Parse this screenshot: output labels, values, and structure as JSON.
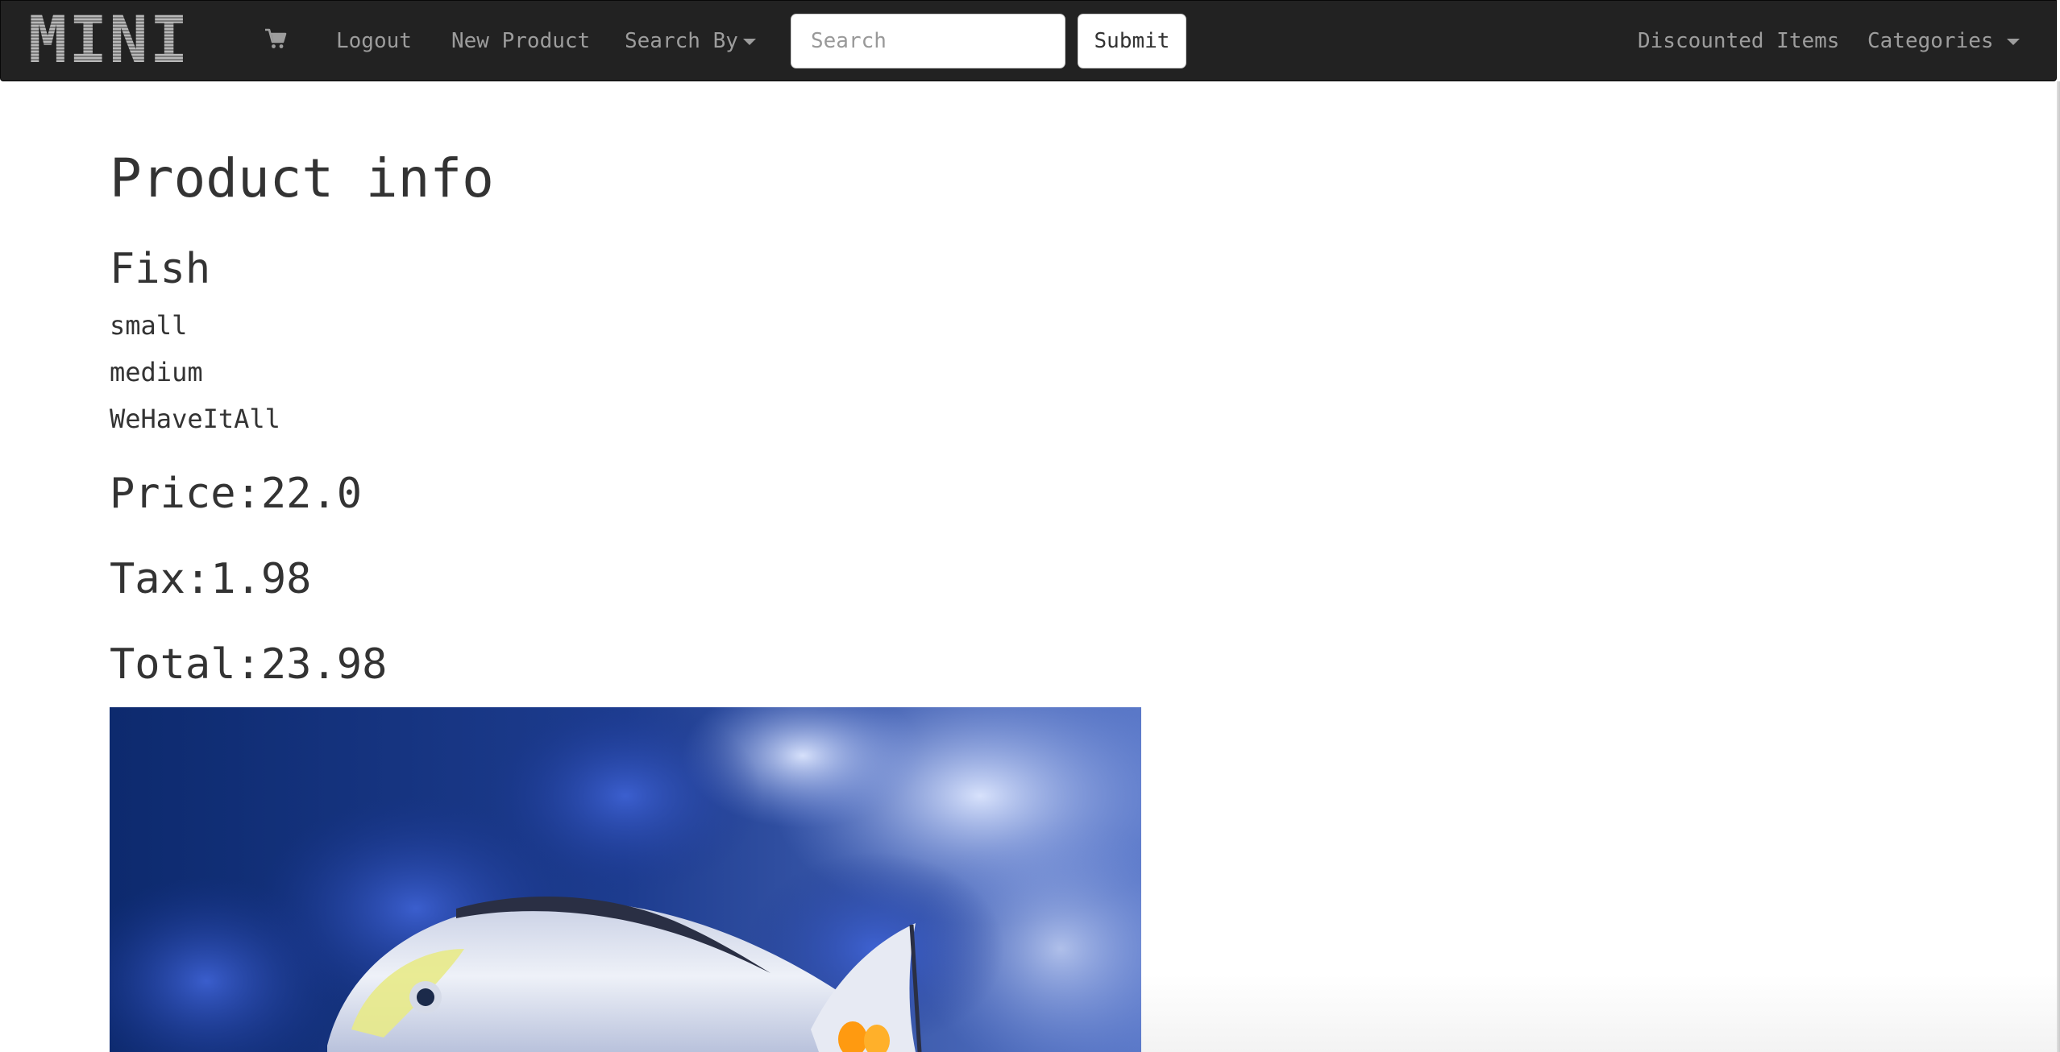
{
  "navbar": {
    "brand": "MINI",
    "cart_icon": "shopping-cart-icon",
    "links": {
      "logout": "Logout",
      "new_product": "New Product",
      "search_by": "Search By",
      "discounted": "Discounted Items",
      "categories": "Categories"
    },
    "search": {
      "placeholder": "Search",
      "value": ""
    },
    "submit_label": "Submit",
    "colors": {
      "background": "#222222",
      "link": "#9d9d9d"
    }
  },
  "main": {
    "title": "Product info",
    "product_name": "Fish",
    "attributes": [
      "small",
      "medium",
      "WeHaveItAll"
    ],
    "price_label": "Price:22.0",
    "tax_label": "Tax:1.98",
    "total_label": "Total:23.98"
  }
}
